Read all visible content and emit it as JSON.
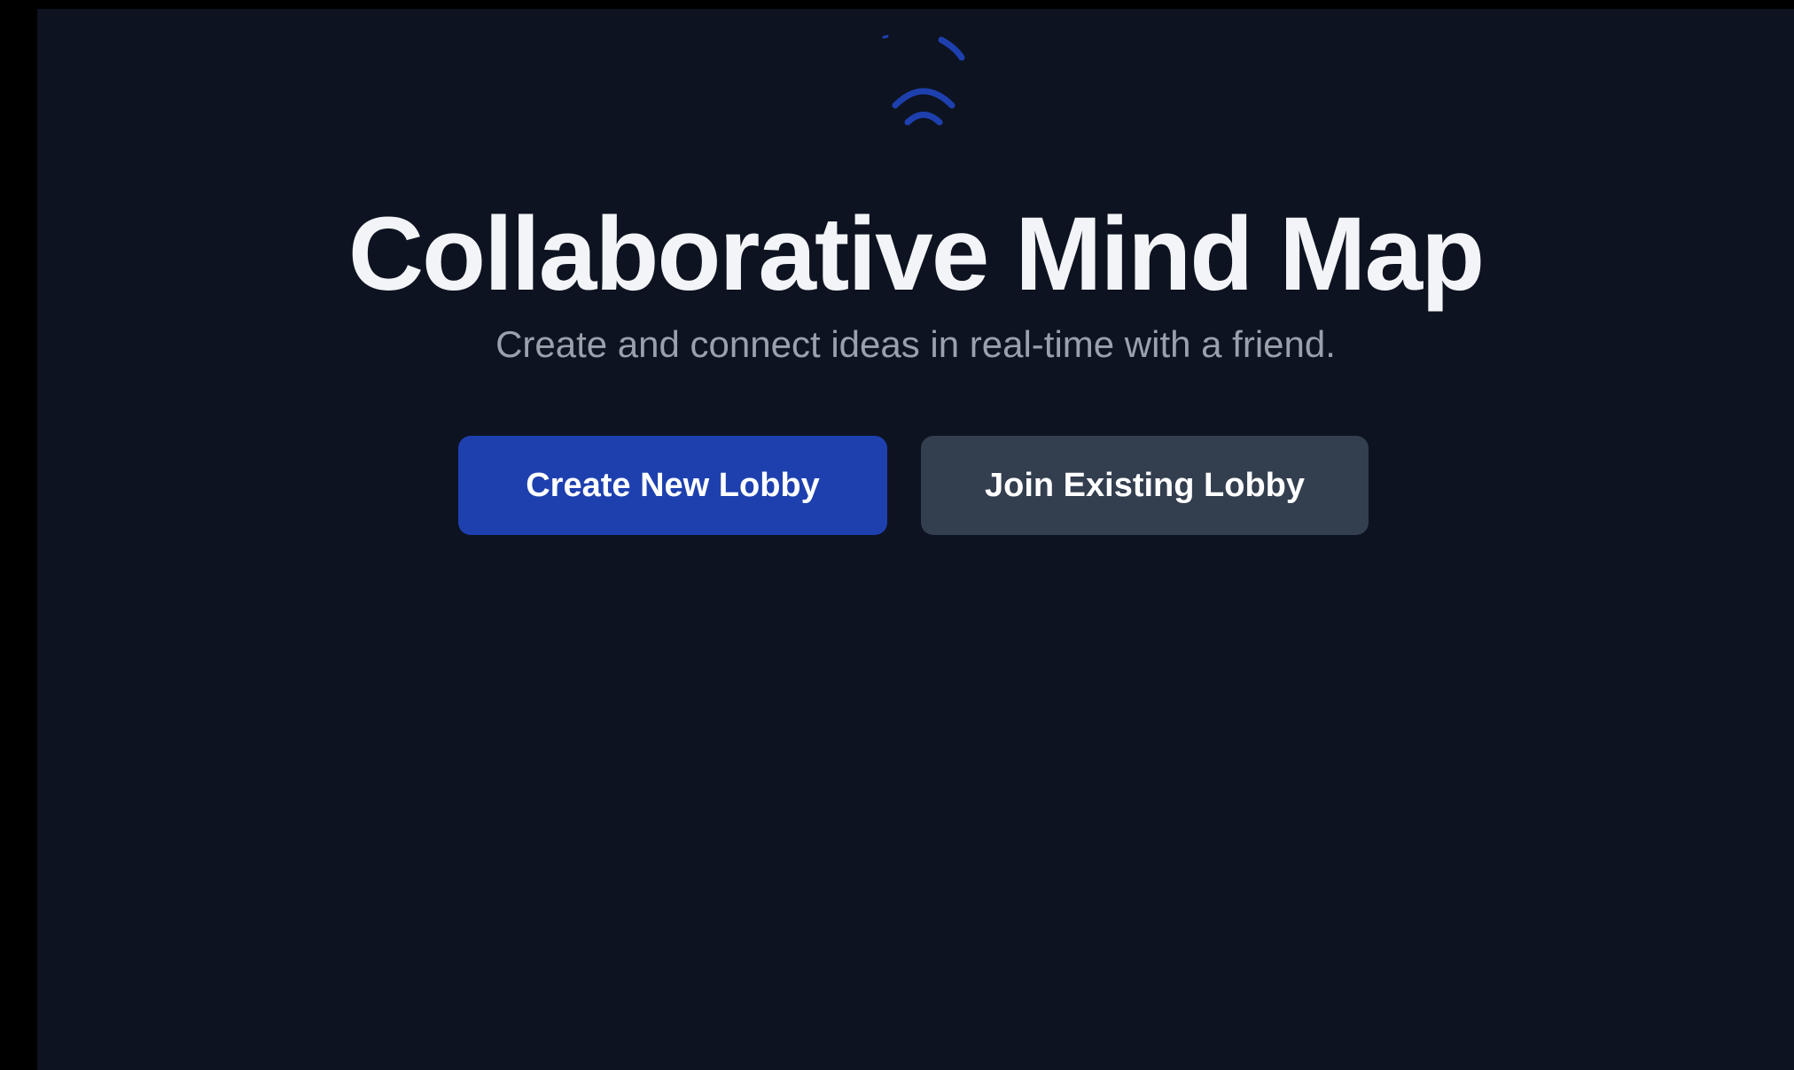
{
  "brand": {
    "logo_icon": "signal-waves-icon",
    "accent_color": "#1e40af"
  },
  "hero": {
    "title": "Collaborative Mind Map",
    "subtitle": "Create and connect ideas in real-time with a friend."
  },
  "actions": {
    "create_label": "Create New Lobby",
    "join_label": "Join Existing Lobby",
    "create_color": "#1e40af",
    "join_color": "#333e4f"
  },
  "colors": {
    "background": "#0d1320",
    "title": "#f3f4f7",
    "subtitle": "#9aa1ac"
  }
}
